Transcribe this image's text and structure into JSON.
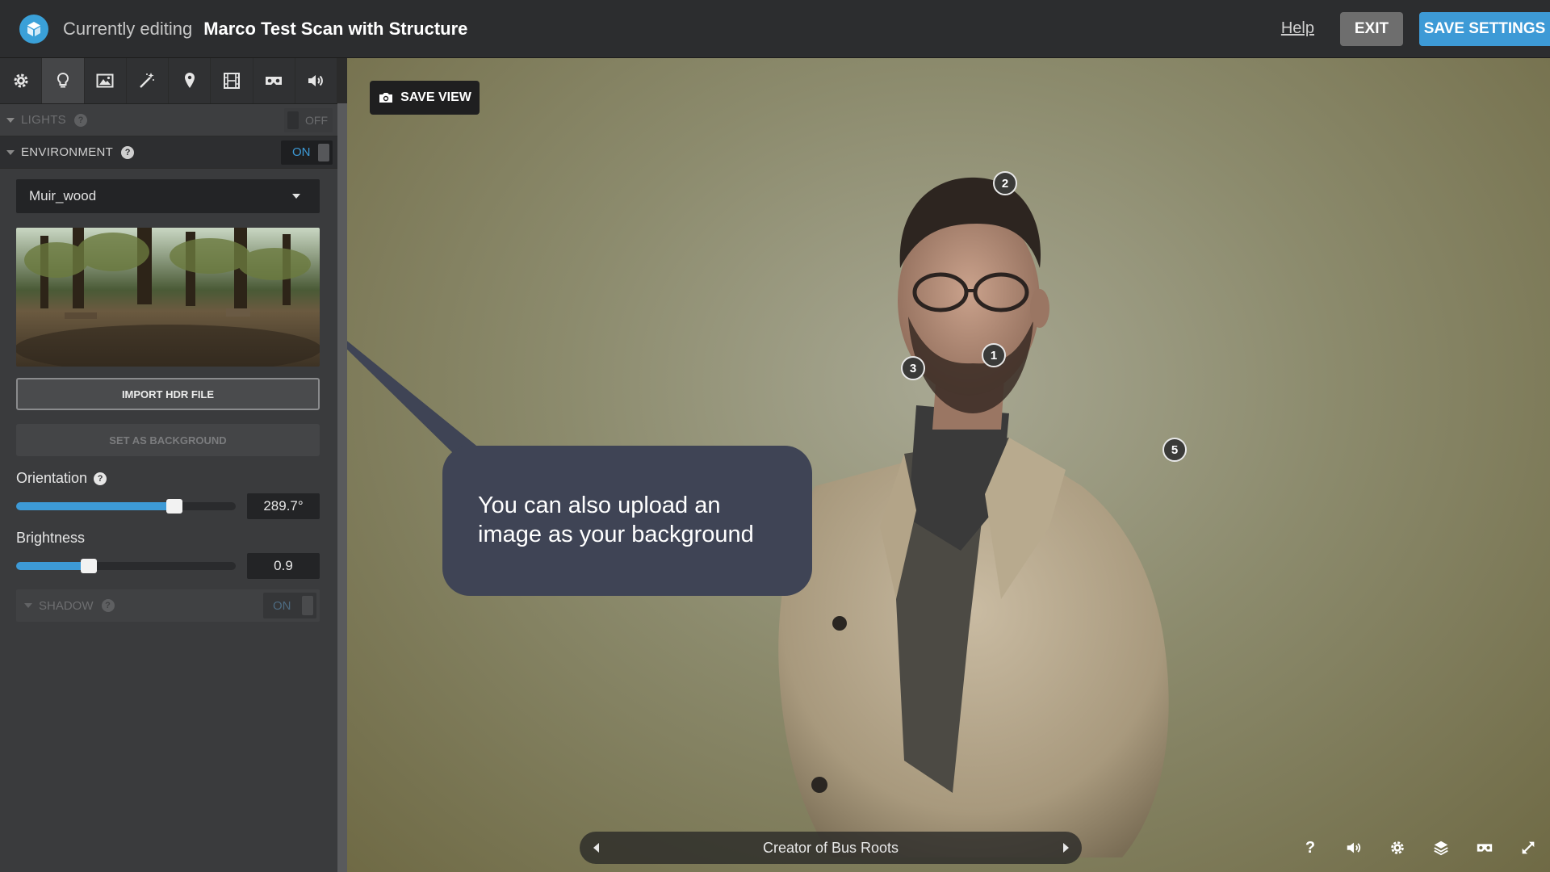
{
  "header": {
    "prefix": "Currently editing",
    "model_name": "Marco Test Scan with Structure",
    "help_label": "Help",
    "exit_label": "EXIT",
    "save_settings_label": "SAVE SETTINGS"
  },
  "sidebar": {
    "tabs": [
      "gear-icon",
      "lightbulb-icon",
      "image-icon",
      "magic-wand-icon",
      "pin-icon",
      "film-icon",
      "vr-icon",
      "sound-icon"
    ],
    "active_tab": 1,
    "lights": {
      "label": "LIGHTS",
      "toggle": "OFF"
    },
    "environment": {
      "label": "ENVIRONMENT",
      "toggle": "ON",
      "selected": "Muir_wood",
      "import_label": "IMPORT HDR FILE",
      "set_background_label": "SET AS BACKGROUND",
      "orientation": {
        "label": "Orientation",
        "value": "289.7°",
        "fraction": 0.72
      },
      "brightness": {
        "label": "Brightness",
        "value": "0.9",
        "fraction": 0.33
      },
      "shadow": {
        "label": "SHADOW",
        "toggle": "ON"
      }
    }
  },
  "viewer": {
    "save_view_label": "SAVE VIEW",
    "tooltip": "You can also upload an image as your background",
    "annotation_title": "Creator of Bus Roots",
    "hotspots": [
      "1",
      "2",
      "3",
      "5"
    ],
    "controls": [
      "help-icon",
      "sound-icon",
      "settings-icon",
      "layers-icon",
      "vr-icon",
      "fullscreen-icon"
    ],
    "help_glyph": "?"
  },
  "colors": {
    "accent": "#3d9ad6",
    "tooltip_bg": "#3f4455",
    "sidebar_bg": "#3a3b3d"
  }
}
